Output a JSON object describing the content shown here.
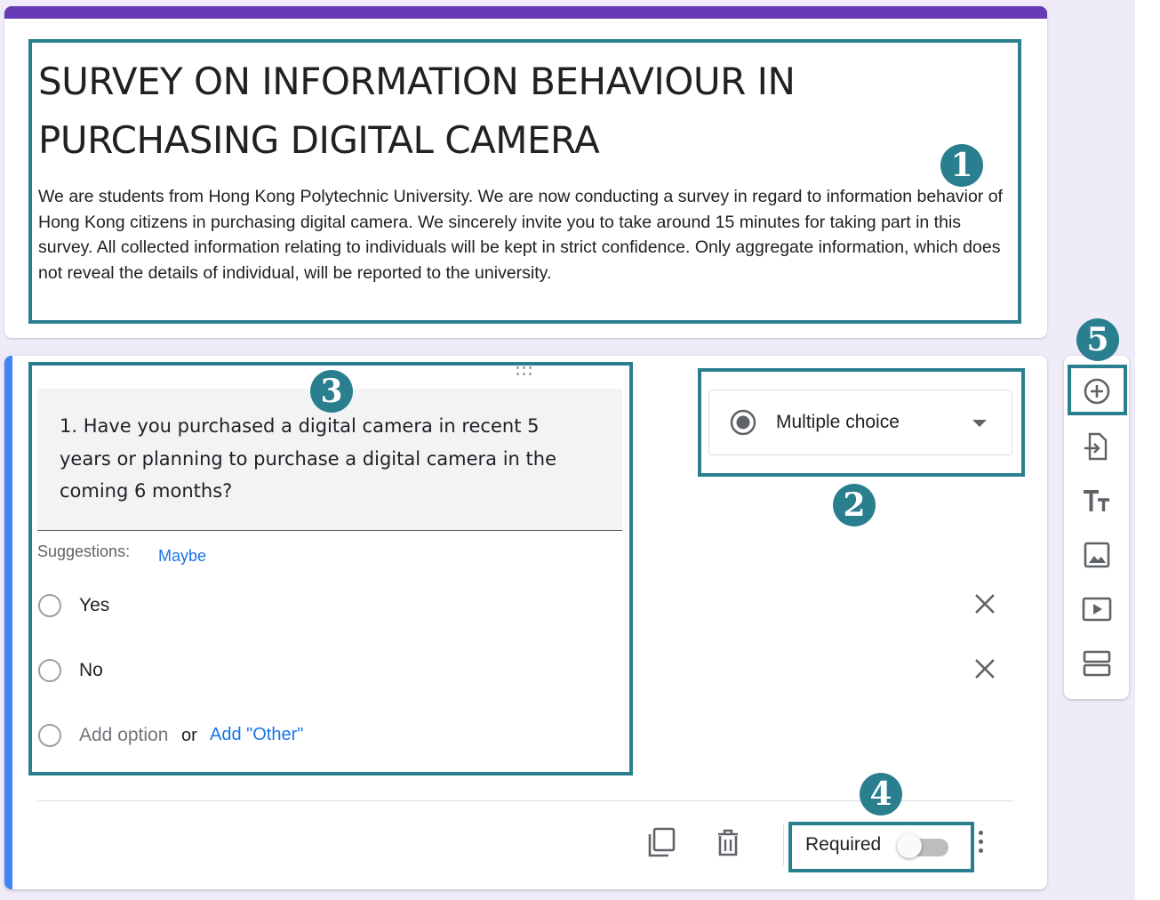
{
  "form": {
    "title": "SURVEY ON INFORMATION BEHAVIOUR IN PURCHASING DIGITAL CAMERA",
    "description": "We are students from Hong Kong Polytechnic University.  We are now conducting a survey in regard to information behavior of Hong Kong citizens in purchasing digital camera.  We sincerely invite you to take around 15 minutes for taking part in this survey.  All collected information relating to individuals will be kept in strict confidence.  Only aggregate information, which does not reveal the details of individual, will be reported to the university."
  },
  "question": {
    "text": "1. Have you purchased a digital camera in recent 5 years or planning to purchase a digital camera in the coming 6 months?",
    "suggestions_label": "Suggestions:",
    "suggestion": "Maybe",
    "options": [
      "Yes",
      "No"
    ],
    "add_option": "Add option",
    "or": "or",
    "add_other": "Add \"Other\"",
    "type": "Multiple choice",
    "required_label": "Required",
    "required": false
  },
  "toolbar_icons": [
    "add-question-icon",
    "import-questions-icon",
    "add-title-description-icon",
    "add-image-icon",
    "add-video-icon",
    "add-section-icon"
  ],
  "annotations": {
    "badge_1": "1",
    "badge_2": "2",
    "badge_3": "3",
    "badge_4": "4",
    "badge_5": "5"
  },
  "colors": {
    "theme": "#673ab7",
    "background": "#f0ebf8",
    "active_card_bar": "#4285f4",
    "link": "#1a73e8",
    "annotation": "#2a7f8f"
  }
}
